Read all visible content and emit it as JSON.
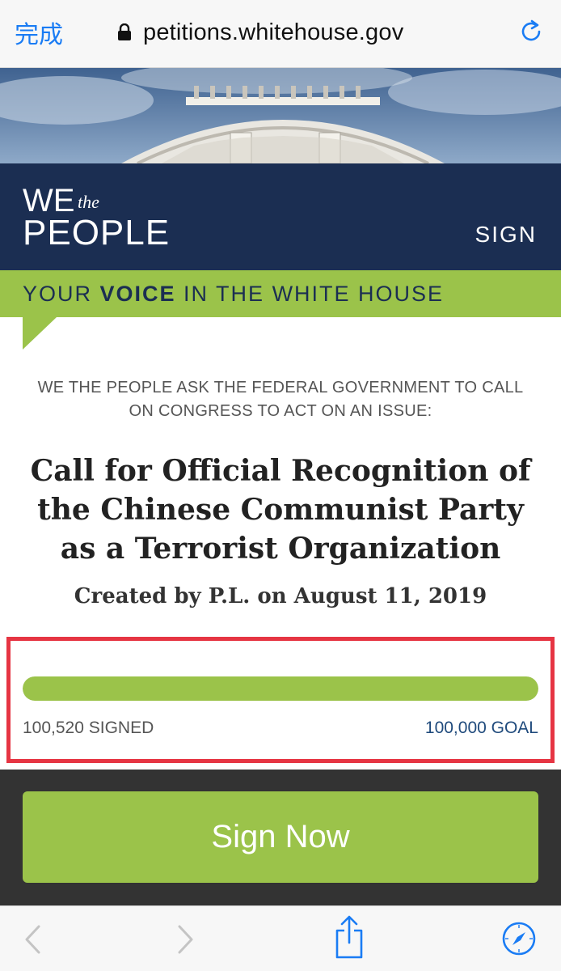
{
  "browser": {
    "done_label": "完成",
    "url": "petitions.whitehouse.gov",
    "icons": {
      "lock": "lock-icon",
      "reload": "reload-icon",
      "back": "chevron-left-icon",
      "forward": "chevron-right-icon",
      "share": "share-icon",
      "safari": "compass-icon"
    }
  },
  "header": {
    "logo_we": "WE",
    "logo_the": "the",
    "logo_people": "PEOPLE",
    "nav_sign": "SIGN",
    "tagline_pre": "YOUR ",
    "tagline_bold": "VOICE",
    "tagline_post": " IN THE WHITE HOUSE"
  },
  "petition": {
    "ask_text": "WE THE PEOPLE ASK THE FEDERAL GOVERNMENT TO CALL ON CONGRESS TO ACT ON AN ISSUE:",
    "title": "Call for Official Recognition of the Chinese Communist Party as a Terrorist Organization",
    "created_by": "Created by P.L. on August 11, 2019",
    "progress_fraction": 1.0,
    "signed_text": "100,520 SIGNED",
    "goal_text": "100,000 GOAL",
    "sign_button": "Sign Now"
  },
  "colors": {
    "navy": "#1b2e52",
    "green": "#9bc34a",
    "highlight_red": "#e63543",
    "link_blue": "#1a7cf4",
    "dark_section": "#333333"
  }
}
